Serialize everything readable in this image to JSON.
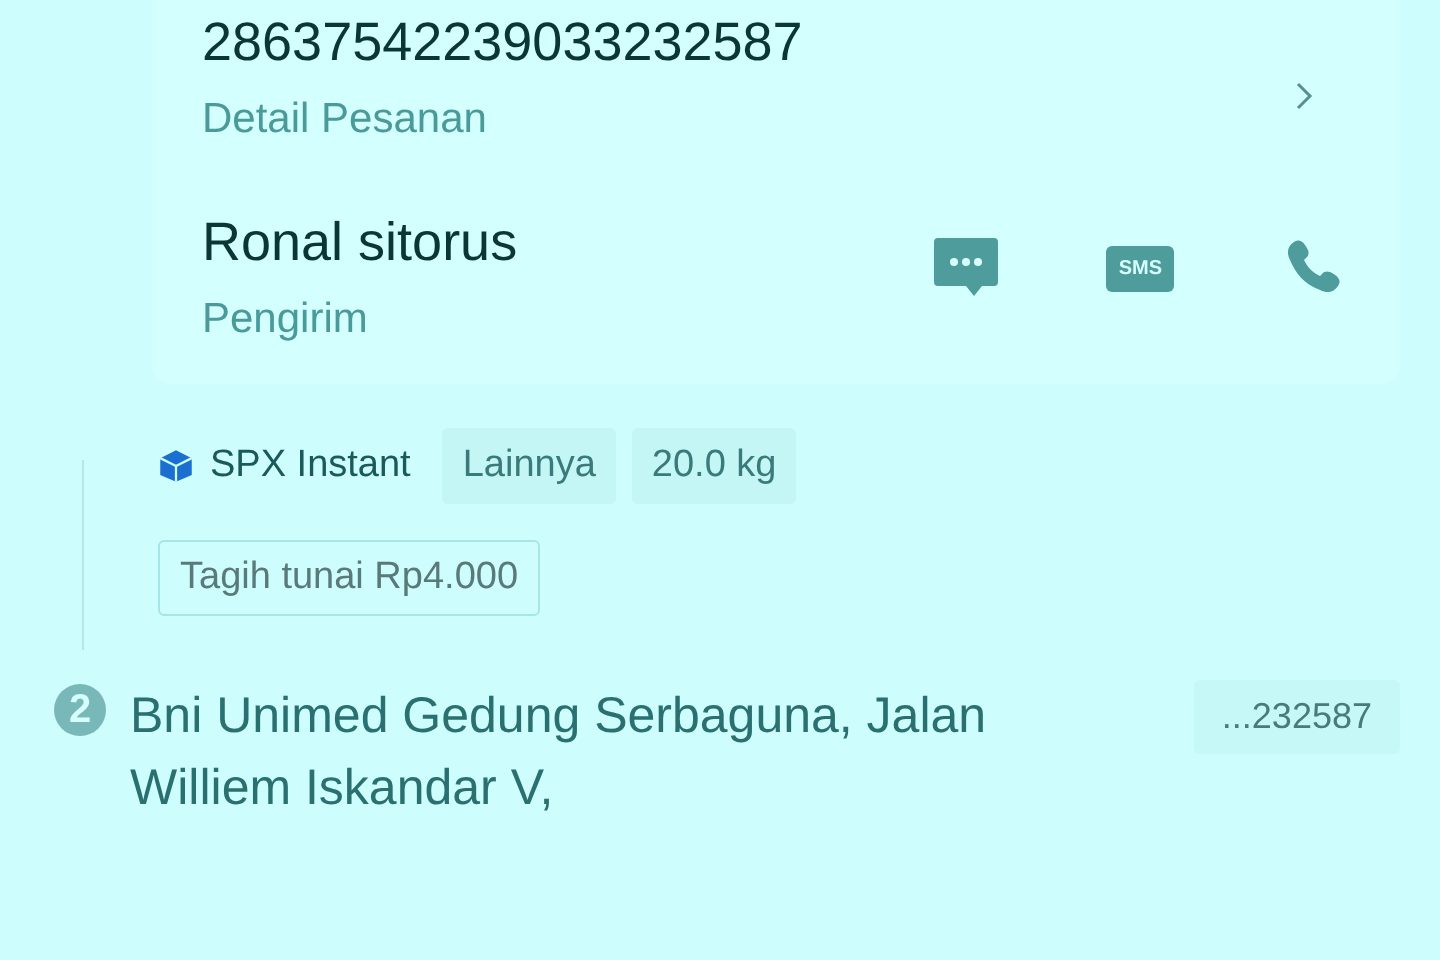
{
  "order": {
    "number": "28637542239033232587",
    "label": "Detail Pesanan"
  },
  "sender": {
    "name": "Ronal sitorus",
    "role": "Pengirim",
    "actions": [
      {
        "kind": "chat"
      },
      {
        "kind": "sms",
        "label": "SMS"
      },
      {
        "kind": "phone"
      }
    ]
  },
  "shipping": {
    "service": "SPX Instant",
    "tags": [
      "Lainnya",
      "20.0 kg"
    ],
    "cod": "Tagih tunai Rp4.000"
  },
  "stop": {
    "step": "2",
    "address": "Bni Unimed Gedung Serbaguna, Jalan Williem Iskandar V,",
    "ref": "...232587"
  }
}
